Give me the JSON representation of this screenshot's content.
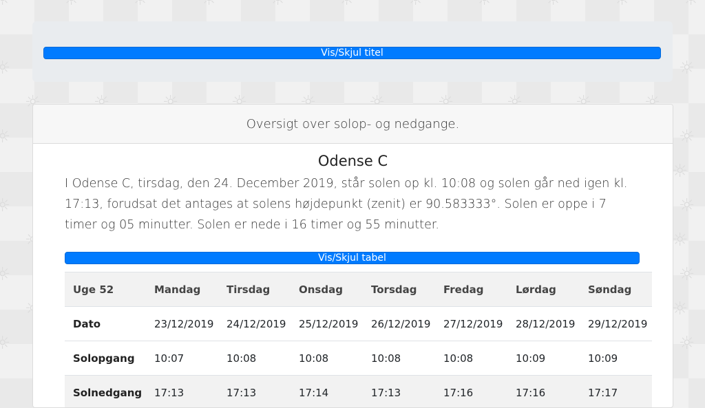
{
  "header": {
    "toggle_title_label": "Vis/Skjul titel"
  },
  "card": {
    "header_title": "Oversigt over solop- og nedgange.",
    "city": "Odense C",
    "description": "I Odense C, tirsdag, den 24. December 2019, står solen op kl. 10:08 og solen går ned igen kl. 17:13, forudsat det antages at solens højdepunkt (zenit) er 90.583333°. Solen er oppe i 7 timer og 05 minutter. Solen er nede i 16 timer og 55 minutter.",
    "toggle_table_label": "Vis/Skjul tabel"
  },
  "table": {
    "week_label": "Uge 52",
    "days": [
      "Mandag",
      "Tirsdag",
      "Onsdag",
      "Torsdag",
      "Fredag",
      "Lørdag",
      "Søndag"
    ],
    "rows": [
      {
        "label": "Dato",
        "values": [
          "23/12/2019",
          "24/12/2019",
          "25/12/2019",
          "26/12/2019",
          "27/12/2019",
          "28/12/2019",
          "29/12/2019"
        ]
      },
      {
        "label": "Solopgang",
        "values": [
          "10:07",
          "10:08",
          "10:08",
          "10:08",
          "10:08",
          "10:09",
          "10:09"
        ]
      },
      {
        "label": "Solnedgang",
        "values": [
          "17:13",
          "17:13",
          "17:14",
          "17:13",
          "17:16",
          "17:16",
          "17:17"
        ]
      }
    ]
  },
  "colors": {
    "primary": "#007bff",
    "jumbotron": "#e9ecef"
  }
}
